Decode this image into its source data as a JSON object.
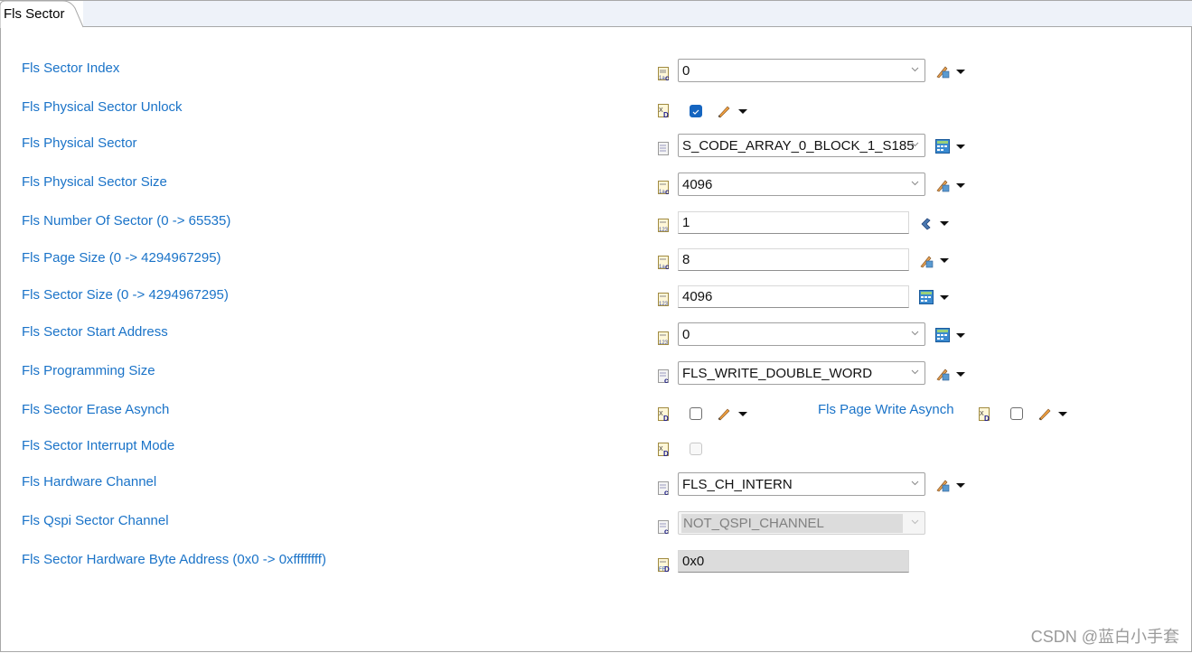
{
  "tab": {
    "label": "Fls Sector"
  },
  "fields": {
    "sector_index": {
      "label": "Fls Sector Index",
      "value": "0"
    },
    "physical_sector_unlock": {
      "label": "Fls Physical Sector Unlock",
      "checked": true
    },
    "physical_sector": {
      "label": "Fls Physical Sector",
      "value": "S_CODE_ARRAY_0_BLOCK_1_S185"
    },
    "physical_sector_size": {
      "label": "Fls Physical Sector Size",
      "value": "4096"
    },
    "number_of_sector": {
      "label": "Fls Number Of Sector (0 -> 65535)",
      "value": "1"
    },
    "page_size": {
      "label": "Fls Page Size (0 -> 4294967295)",
      "value": "8"
    },
    "sector_size": {
      "label": "Fls Sector Size (0 -> 4294967295)",
      "value": "4096"
    },
    "sector_start_address": {
      "label": "Fls Sector Start Address",
      "value": "0"
    },
    "programming_size": {
      "label": "Fls Programming Size",
      "value": "FLS_WRITE_DOUBLE_WORD"
    },
    "sector_erase_asynch": {
      "label": "Fls Sector Erase Asynch",
      "checked": false
    },
    "page_write_asynch": {
      "label": "Fls Page Write Asynch",
      "checked": false
    },
    "sector_interrupt_mode": {
      "label": "Fls Sector Interrupt Mode",
      "checked": false,
      "disabled": true
    },
    "hardware_channel": {
      "label": "Fls Hardware Channel",
      "value": "FLS_CH_INTERN"
    },
    "qspi_sector_channel": {
      "label": "Fls Qspi Sector Channel",
      "value": "NOT_QSPI_CHANNEL",
      "disabled": true
    },
    "hw_byte_address": {
      "label": "Fls Sector Hardware Byte Address (0x0 -> 0xffffffff)",
      "value": "0x0",
      "readonly": true
    }
  },
  "watermark": "CSDN @蓝白小手套"
}
